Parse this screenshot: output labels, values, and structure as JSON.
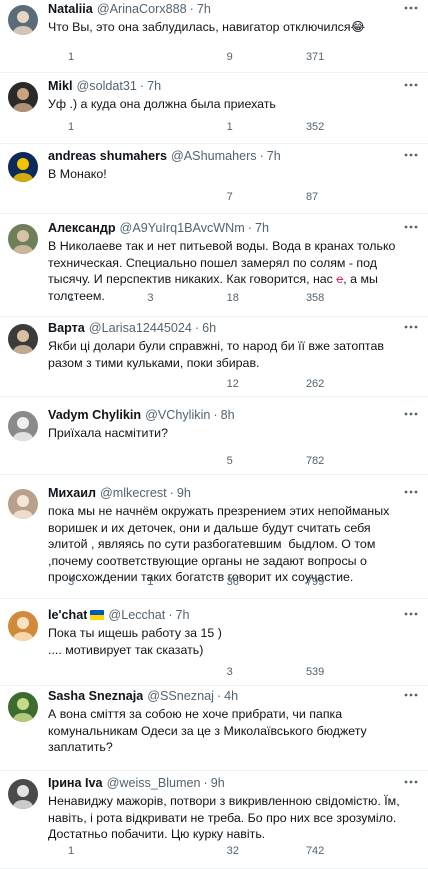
{
  "tweets": [
    {
      "name": "Nataliia",
      "handle": "@ArinaCorx888",
      "time": "7h",
      "text": "Что Вы, это она заблудилась, навигатор отключился😂",
      "replies": "1",
      "reposts": "",
      "likes": "9",
      "views": "371",
      "avatar": {
        "bg": "#5a6b7a",
        "fg": "#e8d6c3"
      }
    },
    {
      "name": "Mikl",
      "handle": "@soldat31",
      "time": "7h",
      "text": "Уф .) а куда она должна была приехать",
      "replies": "1",
      "reposts": "",
      "likes": "1",
      "views": "352",
      "avatar": {
        "bg": "#2a2a2a",
        "fg": "#c9a27e"
      }
    },
    {
      "name": "andreas shumahers",
      "handle": "@AShumahers",
      "time": "7h",
      "text": "В Монако!",
      "replies": "",
      "reposts": "",
      "likes": "7",
      "views": "87",
      "avatar": {
        "bg": "#0b2a5a",
        "fg": "#f3c400"
      }
    },
    {
      "name": "Александр",
      "handle": "@A9YuIrq1BAvcWNm",
      "time": "7h",
      "text_parts": [
        "В Николаеве так и нет питьевой воды. Вода в кранах только техническая. Специально пошел замерял по солям - под тысячу. И перспектив никаких. Как говорится, нас ",
        "е",
        ", а мы толстеем."
      ],
      "replies": "1",
      "reposts": "3",
      "likes": "18",
      "views": "358",
      "avatar": {
        "bg": "#6e7f5a",
        "fg": "#d7c2a8"
      }
    },
    {
      "name": "Варта",
      "handle": "@Larisa12445024",
      "time": "6h",
      "text": "Якби ці долари були справжні, то народ би її вже затоптав разом з тими кульками, поки збирав.",
      "replies": "",
      "reposts": "",
      "likes": "12",
      "views": "262",
      "avatar": {
        "bg": "#3b3b3b",
        "fg": "#d8c0a0"
      }
    },
    {
      "name": "Vadym Chylikin",
      "handle": "@VChylikin",
      "time": "8h",
      "text": "Приїхала насмітити?",
      "replies": "",
      "reposts": "",
      "likes": "5",
      "views": "782",
      "avatar": {
        "bg": "#8a8a8a",
        "fg": "#f0f0f0"
      }
    },
    {
      "name": "Михаил",
      "handle": "@mlkecrest",
      "time": "9h",
      "text": "пока мы не начнём окружать презрением этих непойманых воришек и их деточек, они и дальше будут считать себя элитой , являясь по сути разбогатевшим  быдлом. О том ,почему соответствующие органы не задают вопросы о происхождении таких богатств говорит их соучастие.",
      "replies": "3",
      "reposts": "1",
      "likes": "36",
      "views": "799",
      "avatar": {
        "bg": "#b8a08a",
        "fg": "#f4e6d8"
      }
    },
    {
      "name": "le'chat",
      "handle": "@Lecchat",
      "time": "7h",
      "flag": true,
      "text": "Пока ты ищешь работу за 15 )\n.... мотивирует так сказать)",
      "replies": "",
      "reposts": "",
      "likes": "3",
      "views": "539",
      "avatar": {
        "bg": "#d18a3c",
        "fg": "#fbe3c2"
      }
    },
    {
      "name": "Sasha Sneznaja",
      "handle": "@SSneznaj",
      "time": "4h",
      "text": "А вона сміття за собою не хоче прибрати, чи папка комунальникам Одеси за це з Миколаївського бюджету заплатить?",
      "replies": "",
      "reposts": "",
      "likes": "",
      "views": "",
      "avatar": {
        "bg": "#3e6b2e",
        "fg": "#c9d98a"
      }
    },
    {
      "name": "Ірина Iva",
      "handle": "@weiss_Blumen",
      "time": "9h",
      "text": "Ненавиджу мажорів, потвори з викривленною свідомістю. Їм, навіть, і рота відкривати не треба. Бо про них все зрозуміло. Достатньо побачити. Цю курку навіть.",
      "replies": "1",
      "reposts": "",
      "likes": "32",
      "views": "742",
      "avatar": {
        "bg": "#4a4a4a",
        "fg": "#e2e2e2"
      }
    }
  ],
  "colors": {
    "text": "#0f1419",
    "muted": "#536471",
    "divider": "#eff3f4",
    "flag_blue": "#0057b7",
    "flag_yellow": "#ffd700"
  },
  "icons": [
    "reply-icon",
    "repost-icon",
    "like-icon",
    "views-icon",
    "bookmark-icon",
    "share-icon",
    "more-icon"
  ]
}
